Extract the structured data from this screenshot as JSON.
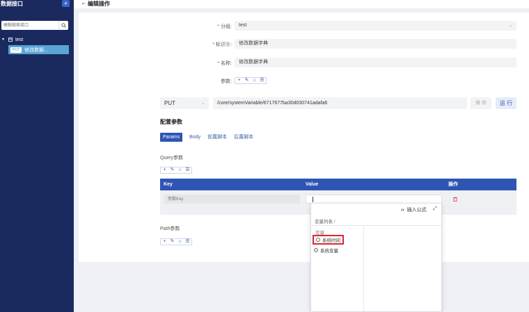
{
  "sidebar": {
    "title": "数据接口",
    "add_label": "+",
    "search_placeholder": "模糊搜索接口",
    "group": {
      "caret": "▼",
      "label": "test"
    },
    "items": [
      {
        "method": "PUT",
        "label": "修改数据..."
      }
    ]
  },
  "header": {
    "title": "编辑操作"
  },
  "form": {
    "group": {
      "label": "分组:",
      "value": "test"
    },
    "identifier": {
      "label": "标识⓪:",
      "value": "修改数据字典"
    },
    "name": {
      "label": "名称:",
      "value": "修改数据字典"
    },
    "params": {
      "label": "参数:"
    }
  },
  "request": {
    "method": "PUT",
    "url": "/core/systemVariable/6717677ba30d030741adafa6",
    "save_label": "保 存",
    "run_label": "运 行"
  },
  "config": {
    "title": "配置参数",
    "tabs": [
      "Params",
      "Body",
      "前置脚本",
      "后置脚本"
    ]
  },
  "query": {
    "title": "Query参数",
    "columns": [
      "Key",
      "Value",
      "操作"
    ],
    "key_placeholder": "参数Key"
  },
  "path": {
    "title": "Path参数"
  },
  "popup": {
    "insert_label": "插入公式",
    "breadcrumb": "变量列表 /",
    "category": "变量",
    "items": [
      "系统时间",
      "系统变量"
    ]
  },
  "colors": {
    "sidebar_bg": "#1b2a5e",
    "accent": "#2f55b3",
    "highlight": "#e0242c"
  }
}
